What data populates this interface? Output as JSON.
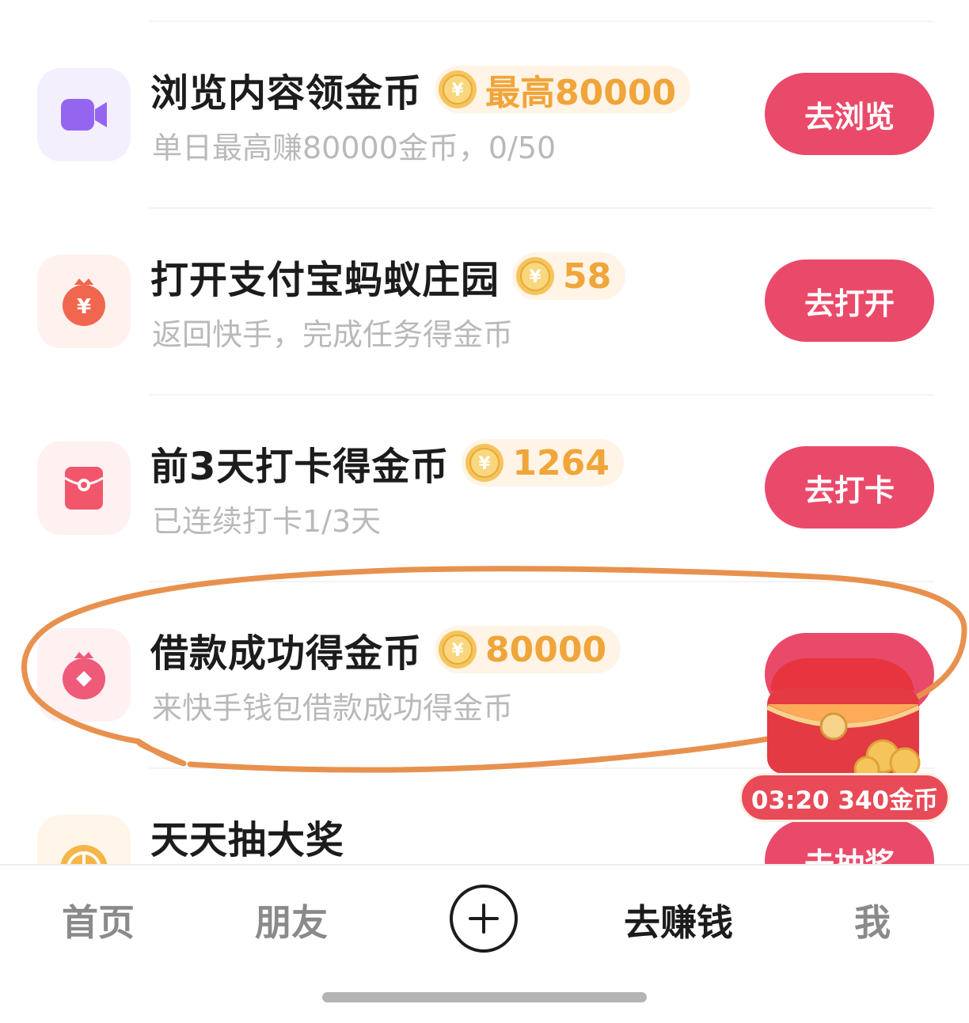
{
  "tasks": [
    {
      "title": "浏览内容领金币",
      "reward": "最高80000",
      "description": "单日最高赚80000金币，0/50",
      "button": "去浏览"
    },
    {
      "title": "打开支付宝蚂蚁庄园",
      "reward": "58",
      "description": "返回快手，完成任务得金币",
      "button": "去打开"
    },
    {
      "title": "前3天打卡得金币",
      "reward": "1264",
      "description": "已连续打卡1/3天",
      "button": "去打卡"
    },
    {
      "title": "借款成功得金币",
      "reward": "80000",
      "description": "来快手钱包借款成功得金币",
      "button": ""
    },
    {
      "title": "天天抽大奖",
      "button": "去抽奖"
    }
  ],
  "floating_reward": {
    "timer_text": "03:20 340金币"
  },
  "bottom_nav": {
    "items": [
      "首页",
      "朋友",
      "去赚钱",
      "我"
    ],
    "active": "去赚钱"
  },
  "colors": {
    "accent": "#ea4a6a",
    "reward": "#f0a53a",
    "annotation": "#e8914f"
  },
  "icons": [
    "video-camera-icon",
    "money-bag-icon",
    "red-envelope-icon",
    "wallet-bag-icon",
    "lottery-wheel-icon",
    "gold-coin-icon",
    "treasure-chest-icon",
    "plus-icon"
  ]
}
